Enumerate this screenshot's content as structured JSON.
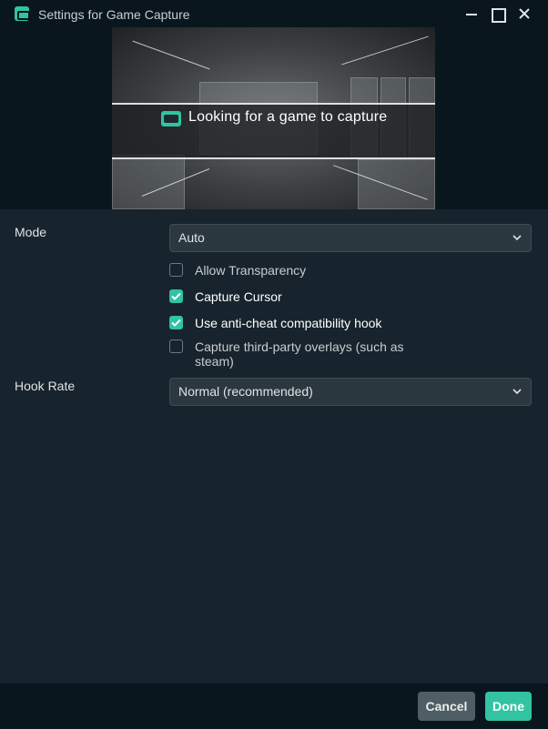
{
  "window": {
    "title": "Settings for Game Capture"
  },
  "preview": {
    "message": "Looking for a game to capture"
  },
  "form": {
    "mode_label": "Mode",
    "mode_value": "Auto",
    "checkboxes": [
      {
        "label": "Allow Transparency",
        "checked": false
      },
      {
        "label": "Capture Cursor",
        "checked": true
      },
      {
        "label": "Use anti-cheat compatibility hook",
        "checked": true
      },
      {
        "label": "Capture third-party overlays (such as steam)",
        "checked": false
      }
    ],
    "hook_rate_label": "Hook Rate",
    "hook_rate_value": "Normal (recommended)"
  },
  "footer": {
    "cancel_label": "Cancel",
    "done_label": "Done"
  },
  "colors": {
    "accent": "#31c3a2",
    "background": "#17242d",
    "chrome": "#09161d"
  }
}
